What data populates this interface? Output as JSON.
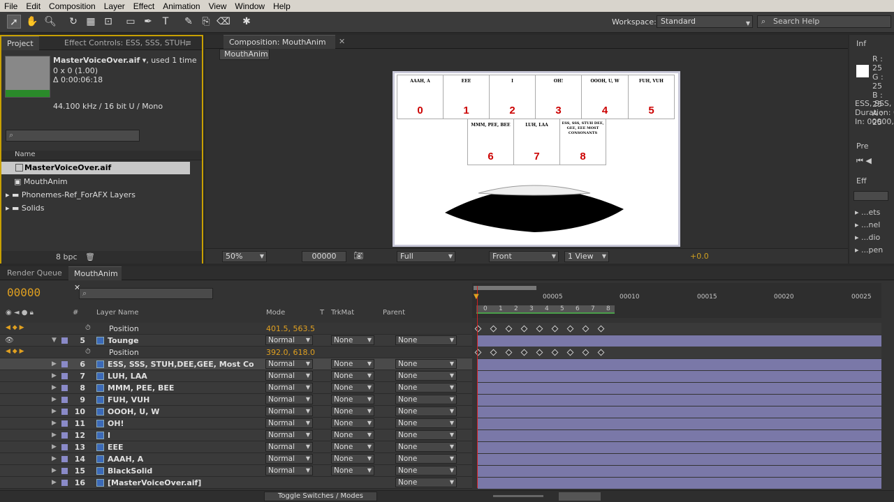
{
  "menu": [
    "File",
    "Edit",
    "Composition",
    "Layer",
    "Effect",
    "Animation",
    "View",
    "Window",
    "Help"
  ],
  "toolbar": {
    "workspace_label": "Workspace:",
    "workspace_value": "Standard",
    "search_placeholder": "Search Help"
  },
  "project": {
    "tab": "Project",
    "effect_tab": "Effect Controls: ESS, SSS, STUH,",
    "file_name": "MasterVoiceOver.aif",
    "file_used": ", used 1 time",
    "dims": "0 x 0 (1.00)",
    "duration": "Δ 0:00:06:18",
    "audio": "44.100 kHz / 16 bit U / Mono",
    "col_name": "Name",
    "items": [
      {
        "label": "MasterVoiceOver.aif",
        "selected": true
      },
      {
        "label": "MouthAnim"
      },
      {
        "label": "Phonemes-Ref_ForAFX Layers"
      },
      {
        "label": "Solids"
      }
    ],
    "bpc": "8 bpc"
  },
  "comp": {
    "tab": "Composition: MouthAnim",
    "subtab": "MouthAnim",
    "zoom": "50%",
    "timecode": "00000",
    "resolution": "Full",
    "view": "Front",
    "views": "1 View",
    "exposure": "+0.0",
    "phonemes_top": [
      {
        "label": "AAAH, A",
        "num": "0"
      },
      {
        "label": "EEE",
        "num": "1"
      },
      {
        "label": "I",
        "num": "2"
      },
      {
        "label": "OH!",
        "num": "3"
      },
      {
        "label": "OOOH, U, W",
        "num": "4"
      },
      {
        "label": "FUH, VUH",
        "num": "5"
      }
    ],
    "phonemes_bottom": [
      {
        "label": "MMM, PEE, BEE",
        "num": "6"
      },
      {
        "label": "LUH, LAA",
        "num": "7"
      },
      {
        "label": "ESS, SSS, STUH DEE, GEE, EEE MOST CONSONANTS",
        "num": "8"
      }
    ]
  },
  "info": {
    "tab": "Inf",
    "r": "R : 25",
    "g": "G : 25",
    "b": "B : 25",
    "a": "A : 25",
    "layer": "ESS, SSS, S",
    "duration": "Duration: 00",
    "in": "In: 00000, (",
    "preview_tab": "Pre",
    "effects_tab": "Eff",
    "effects": [
      "...ets",
      "...nel",
      "...dio",
      "...pen"
    ]
  },
  "timeline": {
    "render_tab": "Render Queue",
    "comp_tab": "MouthAnim",
    "timecode": "00000",
    "col_layer": "Layer Name",
    "col_mode": "Mode",
    "col_t": "T",
    "col_trkmat": "TrkMat",
    "col_parent": "Parent",
    "ruler": [
      "00005",
      "00010",
      "00015",
      "00020",
      "00025"
    ],
    "marker_digits": [
      "0",
      "1",
      "2",
      "3",
      "4",
      "5",
      "6",
      "7",
      "8"
    ],
    "toggle": "Toggle Switches / Modes",
    "position_top": {
      "label": "Position",
      "value": "401.5, 563.5"
    },
    "position_mid": {
      "label": "Position",
      "value": "392.0, 618.0"
    },
    "layers": [
      {
        "num": "5",
        "name": "Tounge",
        "mode": "Normal",
        "trk": "None",
        "parent": "None"
      },
      {
        "num": "6",
        "name": "ESS, SSS, STUH,DEE,GEE, Most Co",
        "mode": "Normal",
        "trk": "None",
        "parent": "None",
        "selected": true
      },
      {
        "num": "7",
        "name": "LUH, LAA",
        "mode": "Normal",
        "trk": "None",
        "parent": "None"
      },
      {
        "num": "8",
        "name": "MMM, PEE, BEE",
        "mode": "Normal",
        "trk": "None",
        "parent": "None"
      },
      {
        "num": "9",
        "name": "FUH, VUH",
        "mode": "Normal",
        "trk": "None",
        "parent": "None"
      },
      {
        "num": "10",
        "name": "OOOH, U, W",
        "mode": "Normal",
        "trk": "None",
        "parent": "None"
      },
      {
        "num": "11",
        "name": "OH!",
        "mode": "Normal",
        "trk": "None",
        "parent": "None"
      },
      {
        "num": "12",
        "name": "I",
        "mode": "Normal",
        "trk": "None",
        "parent": "None"
      },
      {
        "num": "13",
        "name": "EEE",
        "mode": "Normal",
        "trk": "None",
        "parent": "None"
      },
      {
        "num": "14",
        "name": "AAAH, A",
        "mode": "Normal",
        "trk": "None",
        "parent": "None"
      },
      {
        "num": "15",
        "name": "BlackSolid",
        "mode": "Normal",
        "trk": "None",
        "parent": "None"
      },
      {
        "num": "16",
        "name": "[MasterVoiceOver.aif]",
        "mode": "",
        "trk": "",
        "parent": "None"
      }
    ]
  }
}
